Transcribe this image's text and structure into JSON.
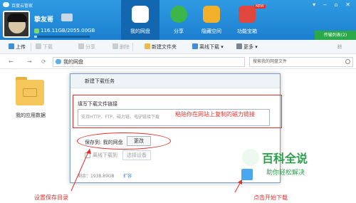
{
  "app": {
    "title": "百度云管家"
  },
  "user": {
    "name": "挚友哥",
    "quota_text": "116.11GB/2055.00GB",
    "quota_fraction": 0.0565
  },
  "nav": {
    "tabs": [
      {
        "label": "我的网盘",
        "icon": "cloud-icon",
        "color": "#ffffff",
        "active": true
      },
      {
        "label": "分享",
        "icon": "share-icon",
        "color": "#3cb64a",
        "active": false
      },
      {
        "label": "隐藏空间",
        "icon": "lock-icon",
        "color": "#f2b02a",
        "active": false
      },
      {
        "label": "功能宝箱",
        "icon": "toolbox-icon",
        "color": "#e0463c",
        "active": false
      }
    ],
    "new_badge": "NEW"
  },
  "transfer_label": "传输列表(2)",
  "toolbar": {
    "upload": "上传",
    "download": "下载",
    "share": "分享",
    "delete": "删除",
    "new_folder": "新建文件夹",
    "offline_download": "离线下载",
    "more": "更多"
  },
  "address": {
    "path": "我的网盘",
    "search_placeholder": "搜索我的网盘文件"
  },
  "folder": {
    "label": "我的应用数据"
  },
  "dialog": {
    "title": "新建下载任务",
    "link_label": "填写下载文件链接",
    "url_placeholder": "支持HTTP、FTP、磁力链、电驴链接下载",
    "save_to": "保存到: 我的网盘",
    "change_button": "更改",
    "offline_to": "离线下载到",
    "select_device": "选择设备",
    "remaining": "剩余：1938.89GB",
    "expand": "扩容"
  },
  "annotations": {
    "paste_hint": "粘贴你在网站上复制的磁力链接",
    "set_dir": "设置保存目录",
    "click_start": "点击开始下载",
    "color": "#e0302c"
  },
  "watermark": {
    "title": "百科全说",
    "subtitle": "助你轻松解决"
  }
}
